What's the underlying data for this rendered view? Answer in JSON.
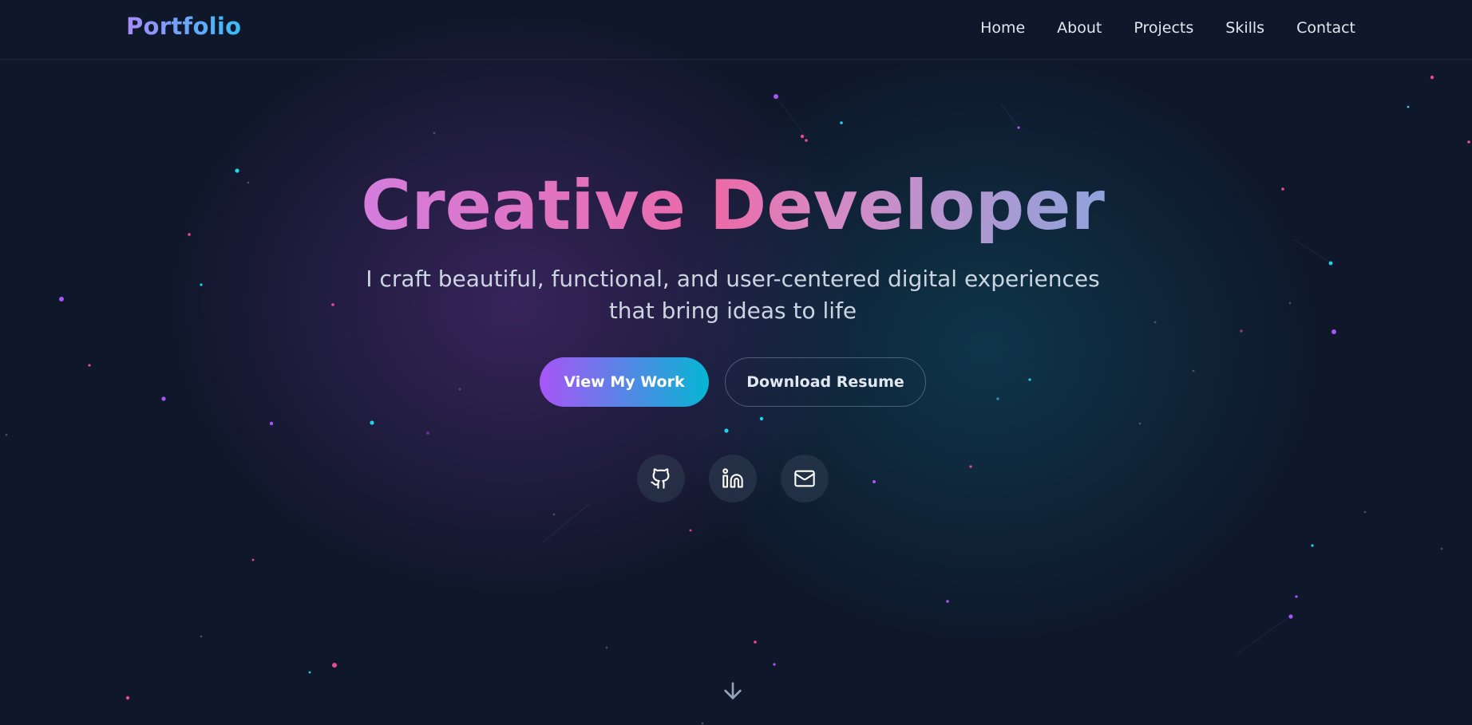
{
  "navbar": {
    "brand": "Portfolio",
    "links": [
      "Home",
      "About",
      "Projects",
      "Skills",
      "Contact"
    ]
  },
  "hero": {
    "title": "Creative Developer",
    "subtitle": "I craft beautiful, functional, and user-centered digital experiences that bring ideas to life",
    "primary_button": "View My Work",
    "secondary_button": "Download Resume"
  },
  "socials": [
    {
      "name": "github",
      "icon": "github-icon"
    },
    {
      "name": "linkedin",
      "icon": "linkedin-icon"
    },
    {
      "name": "email",
      "icon": "mail-icon"
    }
  ],
  "scroll_indicator": {
    "icon": "arrow-down-icon"
  },
  "colors": {
    "background": "#0f172a",
    "accent_purple": "#a855f7",
    "accent_cyan": "#06b6d4",
    "accent_pink": "#ec4899",
    "text": "#e2e8f0",
    "muted_text": "#cbd5e1"
  }
}
